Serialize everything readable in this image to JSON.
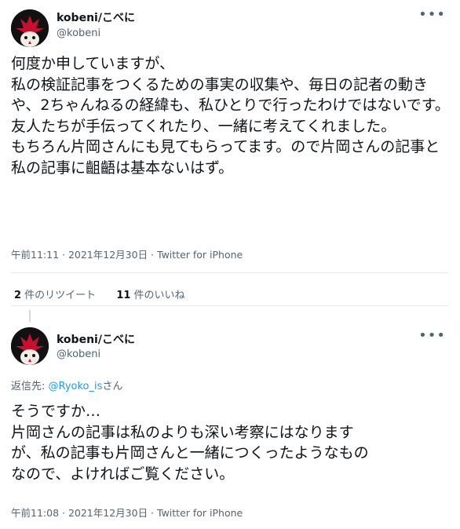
{
  "tweet1": {
    "name": "kobeni/こべに",
    "handle": "@kobeni",
    "text": "何度か申していますが、\n私の検証記事をつくるための事実の収集や、毎日の記者の動きや、2ちゃんねるの経緯も、私ひとりで行ったわけではないです。\n友人たちが手伝ってくれたり、一緒に考えてくれました。\nもちろん片岡さんにも見てもらってます。ので片岡さんの記事と私の記事に齟齬は基本ないはず。",
    "time": "午前11:11 · 2021年12月30日 · ",
    "source": "Twitter for iPhone",
    "retweets_count": "2",
    "retweets_label": " 件のリツイート",
    "likes_count": "11",
    "likes_label": " 件のいいね",
    "more_icon": "more-icon"
  },
  "tweet2": {
    "name": "kobeni/こべに",
    "handle": "@kobeni",
    "reply_prefix": "返信先: ",
    "reply_mention": "@Ryoko_is",
    "reply_suffix": "さん",
    "text": "そうですか…\n片岡さんの記事は私のよりも深い考察にはなります\nが、私の記事も片岡さんと一緒につくったようなもの\nなので、よければご覧ください。",
    "time": "午前11:08 · 2021年12月30日 · ",
    "source": "Twitter for iPhone",
    "more_icon": "more-icon"
  },
  "colors": {
    "text": "#0f1419",
    "secondary": "#536471",
    "link": "#1d9bf0",
    "divider": "#e7e9ea",
    "avatar_bg": "#111111",
    "avatar_accent": "#c8102e"
  }
}
